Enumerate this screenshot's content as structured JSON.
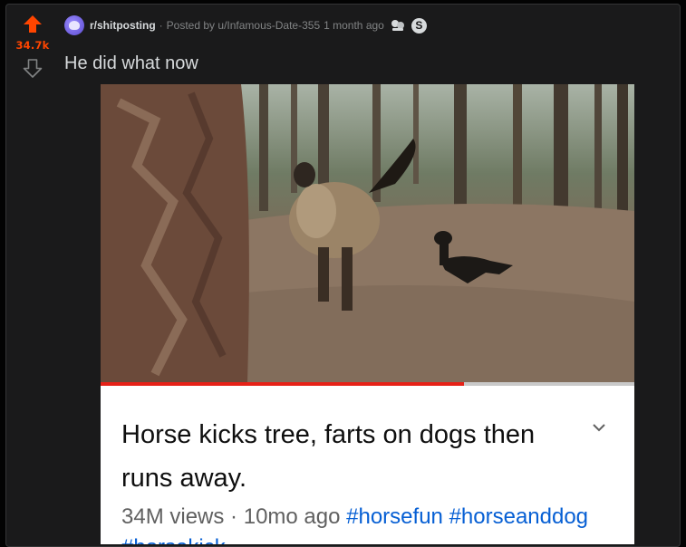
{
  "colors": {
    "accent": "#ff4500",
    "card_bg": "#1a1a1b",
    "text": "#d7dadc",
    "muted": "#818384",
    "link_blue": "#065fd4",
    "progress_red": "#e62117"
  },
  "vote": {
    "score": "34.7k",
    "upvote_icon": "upvote-arrow",
    "downvote_icon": "downvote-arrow"
  },
  "meta": {
    "subreddit": "r/shitposting",
    "separator": "·",
    "posted_by_label": "Posted by",
    "username": "u/Infamous-Date-355",
    "time": "1 month ago",
    "award_icons": [
      "award-icon",
      "coin-icon"
    ]
  },
  "post": {
    "title": "He did what now"
  },
  "video": {
    "progress": 0.68,
    "title": "Horse kicks tree, farts on dogs then runs away.",
    "views": "34M views",
    "separator": "·",
    "age": "10mo ago",
    "hashtags": [
      "#horsefun",
      "#horseanddog",
      "#horsekick"
    ]
  }
}
